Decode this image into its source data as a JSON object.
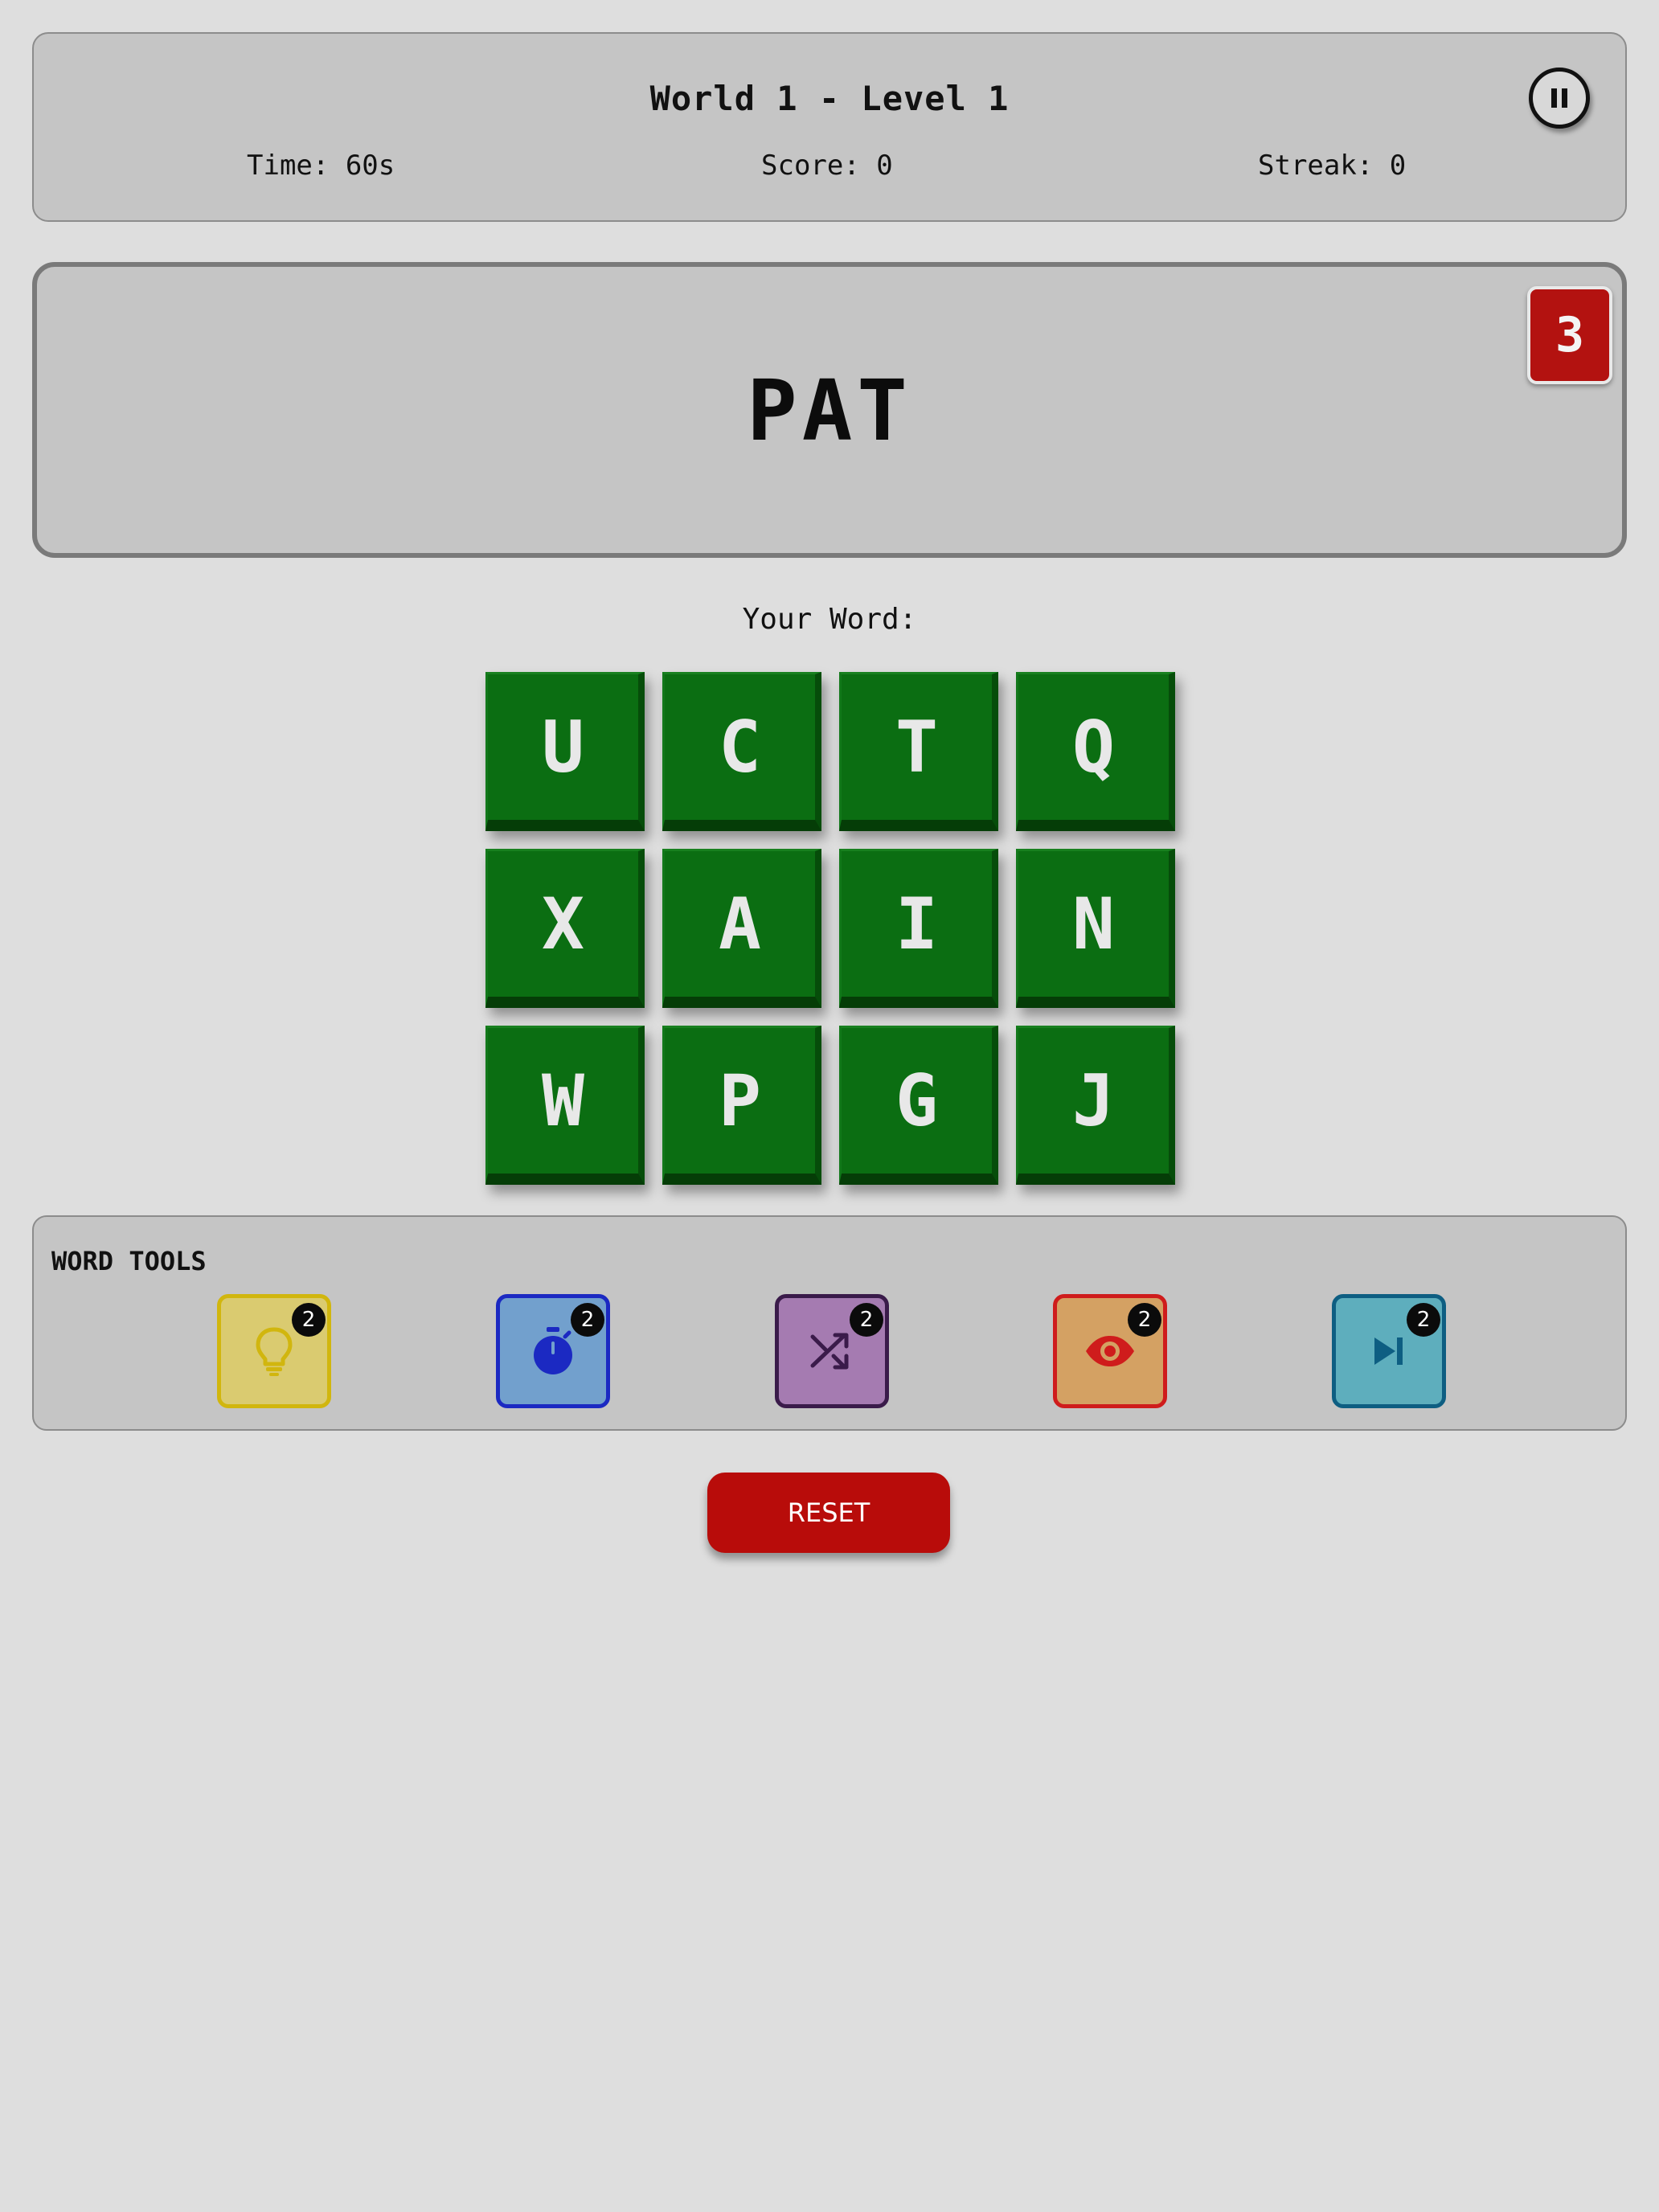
{
  "header": {
    "title": "World 1 - Level 1",
    "time": "Time: 60s",
    "score": "Score: 0",
    "streak": "Streak: 0",
    "pause_icon": "pause-icon"
  },
  "target": {
    "word": "PAT",
    "count": "3"
  },
  "your_word_label": "Your Word:",
  "tiles": [
    [
      "U",
      "C",
      "T",
      "Q"
    ],
    [
      "X",
      "A",
      "I",
      "N"
    ],
    [
      "W",
      "P",
      "G",
      "J"
    ]
  ],
  "tools": {
    "title": "WORD TOOLS",
    "items": [
      {
        "icon": "lightbulb-icon",
        "count": "2",
        "color": "#d1b60e"
      },
      {
        "icon": "stopwatch-icon",
        "count": "2",
        "color": "#1b29c2"
      },
      {
        "icon": "shuffle-icon",
        "count": "2",
        "color": "#3a1b4a"
      },
      {
        "icon": "eye-icon",
        "count": "2",
        "color": "#cf1c1c"
      },
      {
        "icon": "skip-next-icon",
        "count": "2",
        "color": "#0e5e82"
      }
    ]
  },
  "reset_label": "RESET",
  "colors": {
    "tile": "#0b6e12",
    "badge": "#b31210",
    "reset": "#b80c0a",
    "background": "#dedede"
  }
}
